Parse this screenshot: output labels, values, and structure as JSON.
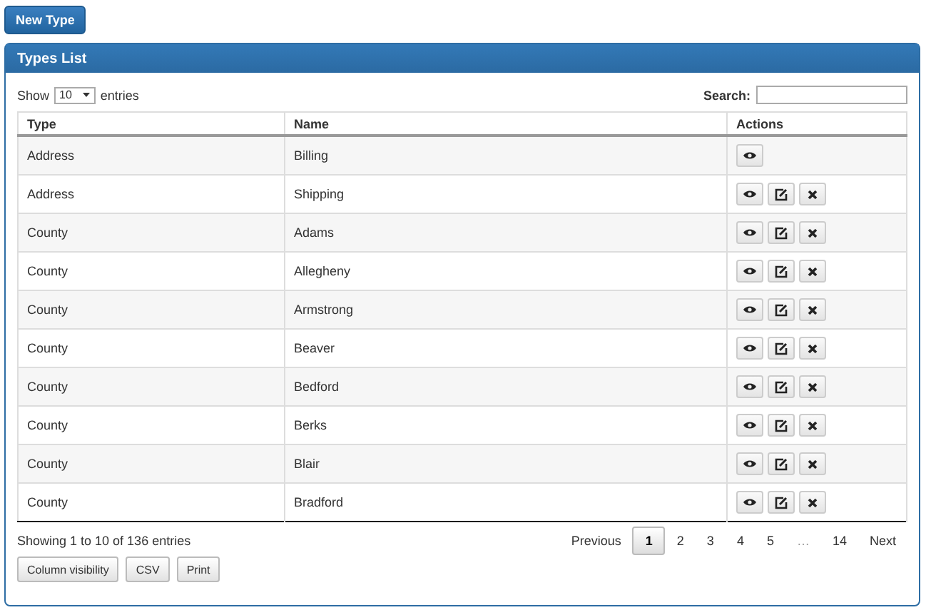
{
  "new_button": "New Type",
  "panel": {
    "title": "Types List"
  },
  "length": {
    "show": "Show",
    "value": "10",
    "entries": "entries"
  },
  "search": {
    "label": "Search:"
  },
  "table": {
    "columns": [
      "Type",
      "Name",
      "Actions"
    ],
    "rows": [
      {
        "type": "Address",
        "name": "Billing",
        "actions": [
          {
            "kind": "view"
          }
        ]
      },
      {
        "type": "Address",
        "name": "Shipping",
        "actions": [
          {
            "kind": "view"
          },
          {
            "kind": "edit"
          },
          {
            "kind": "delete"
          }
        ]
      },
      {
        "type": "County",
        "name": "Adams",
        "actions": [
          {
            "kind": "view"
          },
          {
            "kind": "edit"
          },
          {
            "kind": "delete"
          }
        ]
      },
      {
        "type": "County",
        "name": "Allegheny",
        "actions": [
          {
            "kind": "view"
          },
          {
            "kind": "edit"
          },
          {
            "kind": "delete"
          }
        ]
      },
      {
        "type": "County",
        "name": "Armstrong",
        "actions": [
          {
            "kind": "view"
          },
          {
            "kind": "edit"
          },
          {
            "kind": "delete"
          }
        ]
      },
      {
        "type": "County",
        "name": "Beaver",
        "actions": [
          {
            "kind": "view"
          },
          {
            "kind": "edit"
          },
          {
            "kind": "delete"
          }
        ]
      },
      {
        "type": "County",
        "name": "Bedford",
        "actions": [
          {
            "kind": "view"
          },
          {
            "kind": "edit"
          },
          {
            "kind": "delete"
          }
        ]
      },
      {
        "type": "County",
        "name": "Berks",
        "actions": [
          {
            "kind": "view"
          },
          {
            "kind": "edit"
          },
          {
            "kind": "delete"
          }
        ]
      },
      {
        "type": "County",
        "name": "Blair",
        "actions": [
          {
            "kind": "view"
          },
          {
            "kind": "edit"
          },
          {
            "kind": "delete"
          }
        ]
      },
      {
        "type": "County",
        "name": "Bradford",
        "actions": [
          {
            "kind": "view"
          },
          {
            "kind": "edit"
          },
          {
            "kind": "delete"
          }
        ]
      }
    ]
  },
  "info": "Showing 1 to 10 of 136 entries",
  "pagination": {
    "previous": "Previous",
    "next": "Next",
    "pages": [
      {
        "label": "1",
        "kind": "page",
        "selected": true
      },
      {
        "label": "2",
        "kind": "page",
        "selected": false
      },
      {
        "label": "3",
        "kind": "page",
        "selected": false
      },
      {
        "label": "4",
        "kind": "page",
        "selected": false
      },
      {
        "label": "5",
        "kind": "page",
        "selected": false
      },
      {
        "label": "…",
        "kind": "ellipsis"
      },
      {
        "label": "14",
        "kind": "page",
        "selected": false
      }
    ]
  },
  "export_buttons": [
    "Column visibility",
    "CSV",
    "Print"
  ]
}
